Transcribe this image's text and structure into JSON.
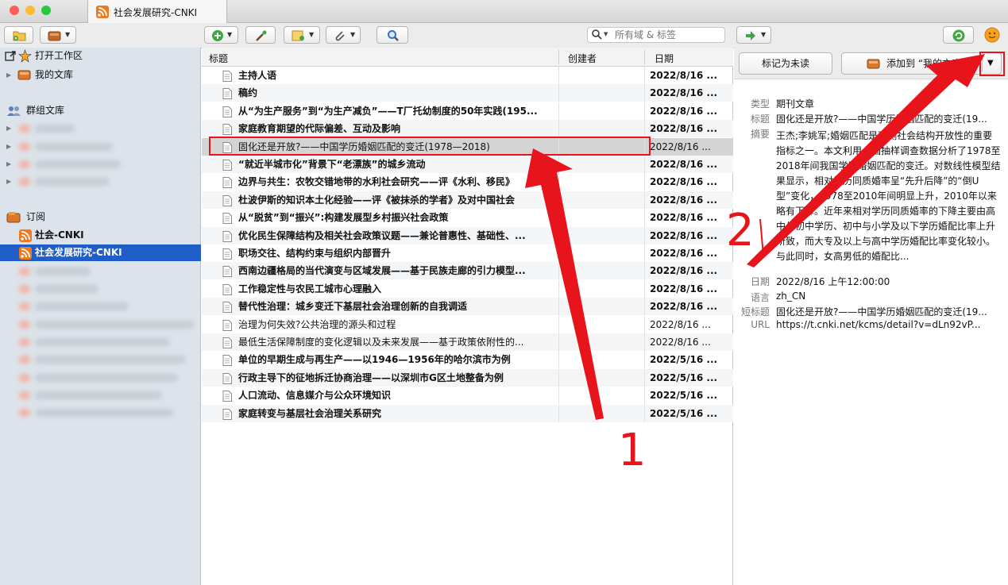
{
  "window": {
    "tab_title": "社会发展研究-CNKI",
    "traffic_lights": [
      "#fe5f57",
      "#febc2e",
      "#28c840"
    ]
  },
  "toolbar": {
    "search_placeholder": "所有域 & 标签"
  },
  "sidebar": {
    "open_workspace": "打开工作区",
    "my_library": "我的文库",
    "group_library": "群组文库",
    "feeds": "订阅",
    "feed_1": "社会-CNKI",
    "feed_2_selected": "社会发展研究-CNKI"
  },
  "list": {
    "col_title": "标题",
    "col_creator": "创建者",
    "col_date": "日期",
    "rows": [
      {
        "title": "主持人语",
        "date": "2022/8/16 ..."
      },
      {
        "title": "稿约",
        "date": "2022/8/16 ..."
      },
      {
        "title": "从“为生产服务”到“为生产减负”——T厂托幼制度的50年实践(195...",
        "date": "2022/8/16 ..."
      },
      {
        "title": "家庭教育期望的代际偏差、互动及影响",
        "date": "2022/8/16 ..."
      },
      {
        "title": "固化还是开放?——中国学历婚姻匹配的变迁(1978—2018)",
        "date": "2022/8/16 ..."
      },
      {
        "title": "“就近半城市化”背景下“老漂族”的城乡流动",
        "date": "2022/8/16 ..."
      },
      {
        "title": "边界与共生：农牧交错地带的水利社会研究——评《水利、移民》",
        "date": "2022/8/16 ..."
      },
      {
        "title": "杜波伊斯的知识本土化经验——评《被抹杀的学者》及对中国社会",
        "date": "2022/8/16 ..."
      },
      {
        "title": "从“脱贫”到“振兴”:构建发展型乡村振兴社会政策",
        "date": "2022/8/16 ..."
      },
      {
        "title": "优化民生保障结构及相关社会政策议题——兼论普惠性、基础性、...",
        "date": "2022/8/16 ..."
      },
      {
        "title": "职场交往、结构约束与组织内部晋升",
        "date": "2022/8/16 ..."
      },
      {
        "title": "西南边疆格局的当代演变与区域发展——基于民族走廊的引力模型...",
        "date": "2022/8/16 ..."
      },
      {
        "title": "工作稳定性与农民工城市心理融入",
        "date": "2022/8/16 ..."
      },
      {
        "title": "替代性治理：城乡变迁下基层社会治理创新的自我调适",
        "date": "2022/8/16 ..."
      },
      {
        "title": "治理为何失效?公共治理的源头和过程",
        "date": "2022/8/16 ..."
      },
      {
        "title": "最低生活保障制度的变化逻辑以及未来发展——基于政策依附性的...",
        "date": "2022/8/16 ..."
      },
      {
        "title": "单位的早期生成与再生产——以1946—1956年的哈尔滨市为例",
        "date": "2022/5/16 ..."
      },
      {
        "title": "行政主导下的征地拆迁协商治理——以深圳市G区土地整备为例",
        "date": "2022/5/16 ..."
      },
      {
        "title": "人口流动、信息媒介与公众环境知识",
        "date": "2022/5/16 ..."
      },
      {
        "title": "家庭转变与基层社会治理关系研究",
        "date": "2022/5/16 ..."
      }
    ]
  },
  "detail": {
    "mark_unread": "标记为未读",
    "add_to": "添加到 “我的文库”",
    "fields": {
      "type_label": "类型",
      "type_value": "期刊文章",
      "title_label": "标题",
      "title_value": "固化还是开放?——中国学历婚姻匹配的变迁(19...",
      "abstract_label": "摘要",
      "abstract_value": "王杰;李姚军;婚姻匹配是观测社会结构开放性的重要指标之一。本文利用全国抽样调查数据分析了1978至2018年间我国学历婚姻匹配的变迁。对数线性模型结果显示，相对学历同质婚率呈“先升后降”的“倒U型”变化，1978至2010年间明显上升，2010年以来略有下降。近年来相对学历同质婚率的下降主要由高中与初中学历、初中与小学及以下学历婚配比率上升所致，而大专及以上与高中学历婚配比率变化较小。与此同时，女高男低的婚配比...",
      "date_label": "日期",
      "date_value": "2022/8/16 上午12:00:00",
      "language_label": "语言",
      "language_value": "zh_CN",
      "short_title_label": "短标题",
      "short_title_value": "固化还是开放?——中国学历婚姻匹配的变迁(19...",
      "url_label": "URL",
      "url_value": "https://t.cnki.net/kcms/detail?v=dLn92vP..."
    }
  },
  "annotations": {
    "label_1": "1",
    "label_2": "2",
    "color": "#e8141c"
  }
}
